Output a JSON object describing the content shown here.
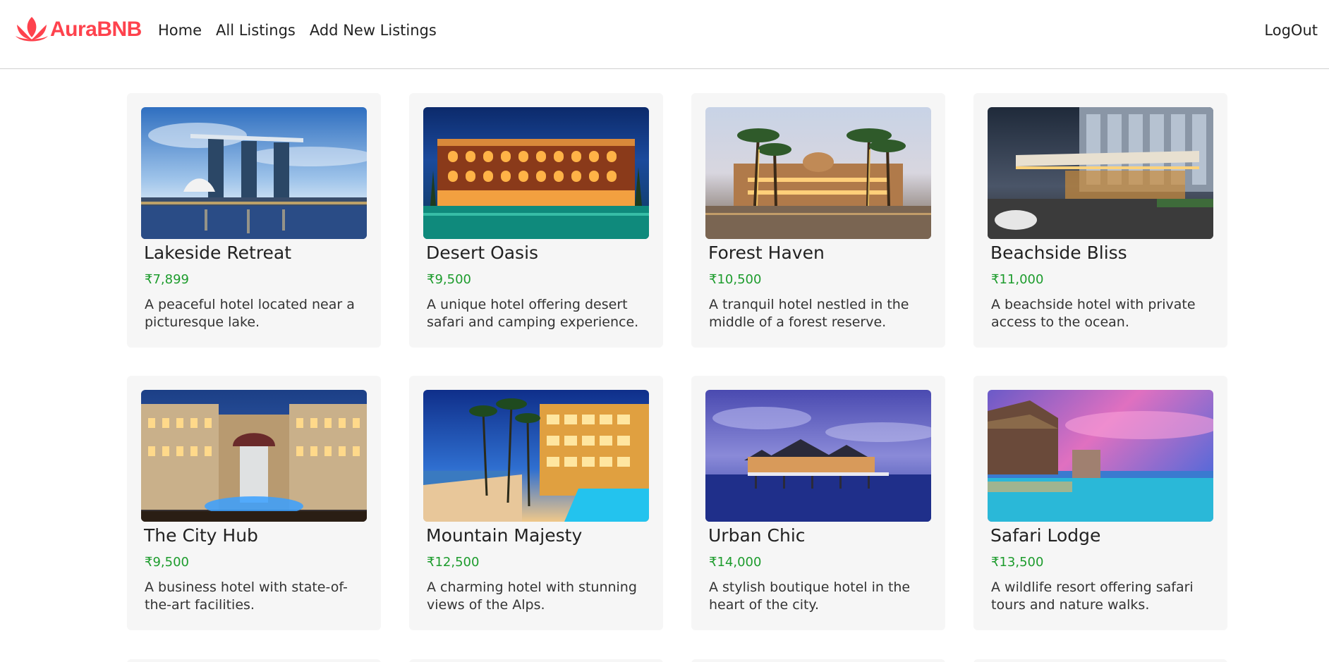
{
  "brand": {
    "name": "AuraBNB",
    "logo_icon": "lotus-icon",
    "color": "#fe424d"
  },
  "nav": {
    "links": [
      "Home",
      "All Listings",
      "Add New Listings"
    ],
    "logout": "LogOut"
  },
  "colors": {
    "price": "#1d9c2d",
    "card_bg": "#f6f6f6"
  },
  "listings": [
    {
      "title": "Lakeside Retreat",
      "price": "₹7,899",
      "description": "A peaceful hotel located near a picturesque lake.",
      "image": "marina-bay-skyline-photo"
    },
    {
      "title": "Desert Oasis",
      "price": "₹9,500",
      "description": "A unique hotel offering desert safari and camping experience.",
      "image": "arabian-palace-hotel-night-photo"
    },
    {
      "title": "Forest Haven",
      "price": "₹10,500",
      "description": "A tranquil hotel nestled in the middle of a forest reserve.",
      "image": "palace-palm-trees-dusk-photo"
    },
    {
      "title": "Beachside Bliss",
      "price": "₹11,000",
      "description": "A beachside hotel with private access to the ocean.",
      "image": "modern-hotel-entrance-night-photo"
    },
    {
      "title": "The City Hub",
      "price": "₹9,500",
      "description": "A business hotel with state-of-the-art facilities.",
      "image": "grand-hotel-fountain-photo"
    },
    {
      "title": "Mountain Majesty",
      "price": "₹12,500",
      "description": "A charming hotel with stunning views of the Alps.",
      "image": "beach-resort-pool-photo"
    },
    {
      "title": "Urban Chic",
      "price": "₹14,000",
      "description": "A stylish boutique hotel in the heart of the city.",
      "image": "overwater-villa-photo"
    },
    {
      "title": "Safari Lodge",
      "price": "₹13,500",
      "description": "A wildlife resort offering safari tours and nature walks.",
      "image": "infinity-pool-sunset-photo"
    }
  ]
}
